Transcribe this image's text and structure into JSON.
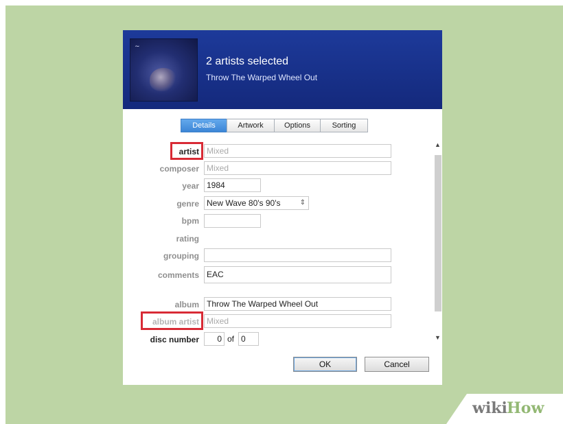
{
  "header": {
    "title": "2 artists selected",
    "subtitle": "Throw The Warped Wheel Out"
  },
  "tabs": [
    {
      "label": "Details",
      "active": true
    },
    {
      "label": "Artwork",
      "active": false
    },
    {
      "label": "Options",
      "active": false
    },
    {
      "label": "Sorting",
      "active": false
    }
  ],
  "fields": {
    "artist": {
      "label": "artist",
      "value": "Mixed"
    },
    "composer": {
      "label": "composer",
      "value": "Mixed"
    },
    "year": {
      "label": "year",
      "value": "1984"
    },
    "genre": {
      "label": "genre",
      "value": "New Wave 80's 90's"
    },
    "bpm": {
      "label": "bpm",
      "value": ""
    },
    "rating": {
      "label": "rating"
    },
    "grouping": {
      "label": "grouping",
      "value": ""
    },
    "comments": {
      "label": "comments",
      "value": "EAC"
    },
    "album": {
      "label": "album",
      "value": "Throw The Warped Wheel Out"
    },
    "album_artist": {
      "label": "album artist",
      "value": "Mixed"
    },
    "disc_number": {
      "label": "disc number",
      "value": "0",
      "of_label": "of",
      "total": "0"
    }
  },
  "buttons": {
    "ok": "OK",
    "cancel": "Cancel"
  },
  "watermark": {
    "wiki": "wiki",
    "how": "How"
  },
  "icons": {
    "scroll_up": "chevron-up-icon",
    "scroll_down": "chevron-down-icon",
    "genre_spinner": "updown-icon"
  },
  "colors": {
    "background": "#bdd5a5",
    "header": "#1a348c",
    "highlight": "#d82a35",
    "active_tab": "#4a93e0"
  }
}
